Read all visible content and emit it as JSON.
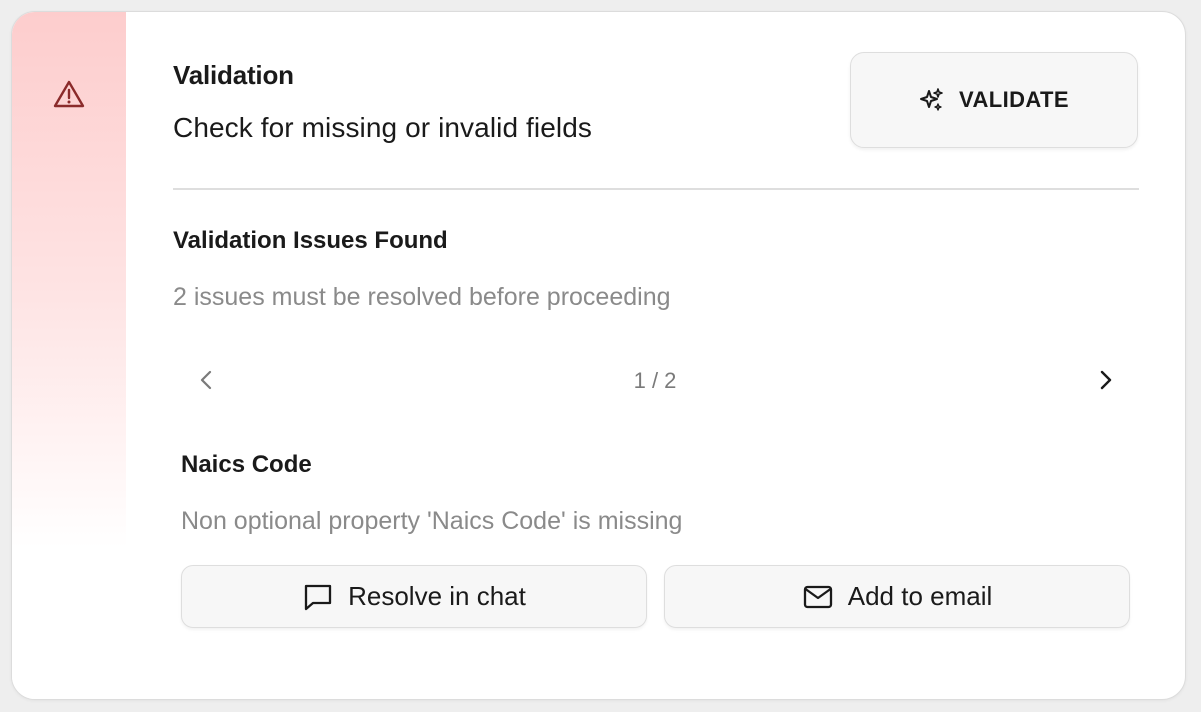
{
  "header": {
    "title": "Validation",
    "subtitle": "Check for missing or invalid fields",
    "validate_label": "VALIDATE",
    "icons": {
      "status": "warning-triangle-icon",
      "validate": "sparkles-icon"
    }
  },
  "issues": {
    "title": "Validation Issues Found",
    "summary": "2 issues must be resolved before proceeding",
    "pager": {
      "label": "1 / 2",
      "current": 1,
      "total": 2
    },
    "current": {
      "field": "Naics Code",
      "message": "Non optional property 'Naics Code' is missing"
    }
  },
  "actions": {
    "resolve_label": "Resolve in chat",
    "email_label": "Add to email"
  },
  "colors": {
    "accent_strip": "#fdcdcd",
    "warning_icon": "#8b2b2b",
    "text_primary": "#1a1a1a",
    "text_muted": "#8a8a8a"
  }
}
